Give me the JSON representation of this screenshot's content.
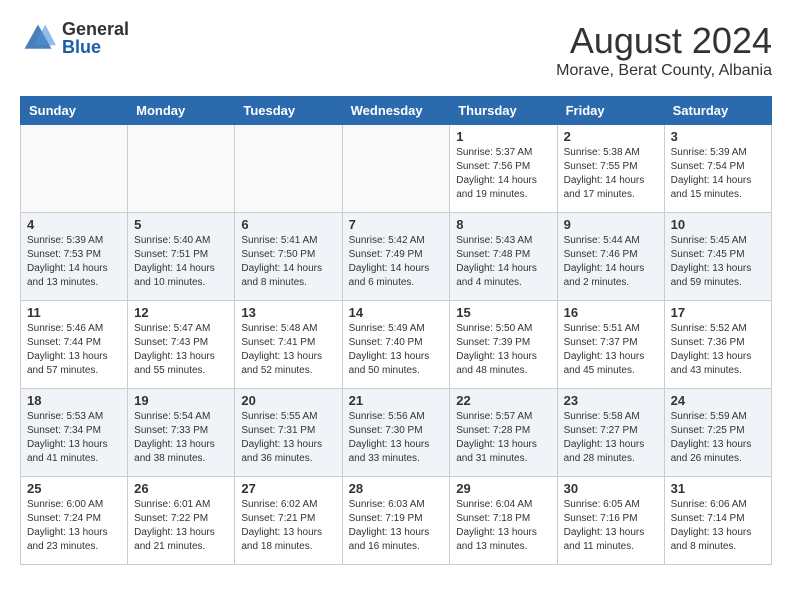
{
  "logo": {
    "general": "General",
    "blue": "Blue"
  },
  "title": "August 2024",
  "location": "Morave, Berat County, Albania",
  "days_header": [
    "Sunday",
    "Monday",
    "Tuesday",
    "Wednesday",
    "Thursday",
    "Friday",
    "Saturday"
  ],
  "weeks": [
    [
      {
        "day": "",
        "info": ""
      },
      {
        "day": "",
        "info": ""
      },
      {
        "day": "",
        "info": ""
      },
      {
        "day": "",
        "info": ""
      },
      {
        "day": "1",
        "info": "Sunrise: 5:37 AM\nSunset: 7:56 PM\nDaylight: 14 hours\nand 19 minutes."
      },
      {
        "day": "2",
        "info": "Sunrise: 5:38 AM\nSunset: 7:55 PM\nDaylight: 14 hours\nand 17 minutes."
      },
      {
        "day": "3",
        "info": "Sunrise: 5:39 AM\nSunset: 7:54 PM\nDaylight: 14 hours\nand 15 minutes."
      }
    ],
    [
      {
        "day": "4",
        "info": "Sunrise: 5:39 AM\nSunset: 7:53 PM\nDaylight: 14 hours\nand 13 minutes."
      },
      {
        "day": "5",
        "info": "Sunrise: 5:40 AM\nSunset: 7:51 PM\nDaylight: 14 hours\nand 10 minutes."
      },
      {
        "day": "6",
        "info": "Sunrise: 5:41 AM\nSunset: 7:50 PM\nDaylight: 14 hours\nand 8 minutes."
      },
      {
        "day": "7",
        "info": "Sunrise: 5:42 AM\nSunset: 7:49 PM\nDaylight: 14 hours\nand 6 minutes."
      },
      {
        "day": "8",
        "info": "Sunrise: 5:43 AM\nSunset: 7:48 PM\nDaylight: 14 hours\nand 4 minutes."
      },
      {
        "day": "9",
        "info": "Sunrise: 5:44 AM\nSunset: 7:46 PM\nDaylight: 14 hours\nand 2 minutes."
      },
      {
        "day": "10",
        "info": "Sunrise: 5:45 AM\nSunset: 7:45 PM\nDaylight: 13 hours\nand 59 minutes."
      }
    ],
    [
      {
        "day": "11",
        "info": "Sunrise: 5:46 AM\nSunset: 7:44 PM\nDaylight: 13 hours\nand 57 minutes."
      },
      {
        "day": "12",
        "info": "Sunrise: 5:47 AM\nSunset: 7:43 PM\nDaylight: 13 hours\nand 55 minutes."
      },
      {
        "day": "13",
        "info": "Sunrise: 5:48 AM\nSunset: 7:41 PM\nDaylight: 13 hours\nand 52 minutes."
      },
      {
        "day": "14",
        "info": "Sunrise: 5:49 AM\nSunset: 7:40 PM\nDaylight: 13 hours\nand 50 minutes."
      },
      {
        "day": "15",
        "info": "Sunrise: 5:50 AM\nSunset: 7:39 PM\nDaylight: 13 hours\nand 48 minutes."
      },
      {
        "day": "16",
        "info": "Sunrise: 5:51 AM\nSunset: 7:37 PM\nDaylight: 13 hours\nand 45 minutes."
      },
      {
        "day": "17",
        "info": "Sunrise: 5:52 AM\nSunset: 7:36 PM\nDaylight: 13 hours\nand 43 minutes."
      }
    ],
    [
      {
        "day": "18",
        "info": "Sunrise: 5:53 AM\nSunset: 7:34 PM\nDaylight: 13 hours\nand 41 minutes."
      },
      {
        "day": "19",
        "info": "Sunrise: 5:54 AM\nSunset: 7:33 PM\nDaylight: 13 hours\nand 38 minutes."
      },
      {
        "day": "20",
        "info": "Sunrise: 5:55 AM\nSunset: 7:31 PM\nDaylight: 13 hours\nand 36 minutes."
      },
      {
        "day": "21",
        "info": "Sunrise: 5:56 AM\nSunset: 7:30 PM\nDaylight: 13 hours\nand 33 minutes."
      },
      {
        "day": "22",
        "info": "Sunrise: 5:57 AM\nSunset: 7:28 PM\nDaylight: 13 hours\nand 31 minutes."
      },
      {
        "day": "23",
        "info": "Sunrise: 5:58 AM\nSunset: 7:27 PM\nDaylight: 13 hours\nand 28 minutes."
      },
      {
        "day": "24",
        "info": "Sunrise: 5:59 AM\nSunset: 7:25 PM\nDaylight: 13 hours\nand 26 minutes."
      }
    ],
    [
      {
        "day": "25",
        "info": "Sunrise: 6:00 AM\nSunset: 7:24 PM\nDaylight: 13 hours\nand 23 minutes."
      },
      {
        "day": "26",
        "info": "Sunrise: 6:01 AM\nSunset: 7:22 PM\nDaylight: 13 hours\nand 21 minutes."
      },
      {
        "day": "27",
        "info": "Sunrise: 6:02 AM\nSunset: 7:21 PM\nDaylight: 13 hours\nand 18 minutes."
      },
      {
        "day": "28",
        "info": "Sunrise: 6:03 AM\nSunset: 7:19 PM\nDaylight: 13 hours\nand 16 minutes."
      },
      {
        "day": "29",
        "info": "Sunrise: 6:04 AM\nSunset: 7:18 PM\nDaylight: 13 hours\nand 13 minutes."
      },
      {
        "day": "30",
        "info": "Sunrise: 6:05 AM\nSunset: 7:16 PM\nDaylight: 13 hours\nand 11 minutes."
      },
      {
        "day": "31",
        "info": "Sunrise: 6:06 AM\nSunset: 7:14 PM\nDaylight: 13 hours\nand 8 minutes."
      }
    ]
  ]
}
